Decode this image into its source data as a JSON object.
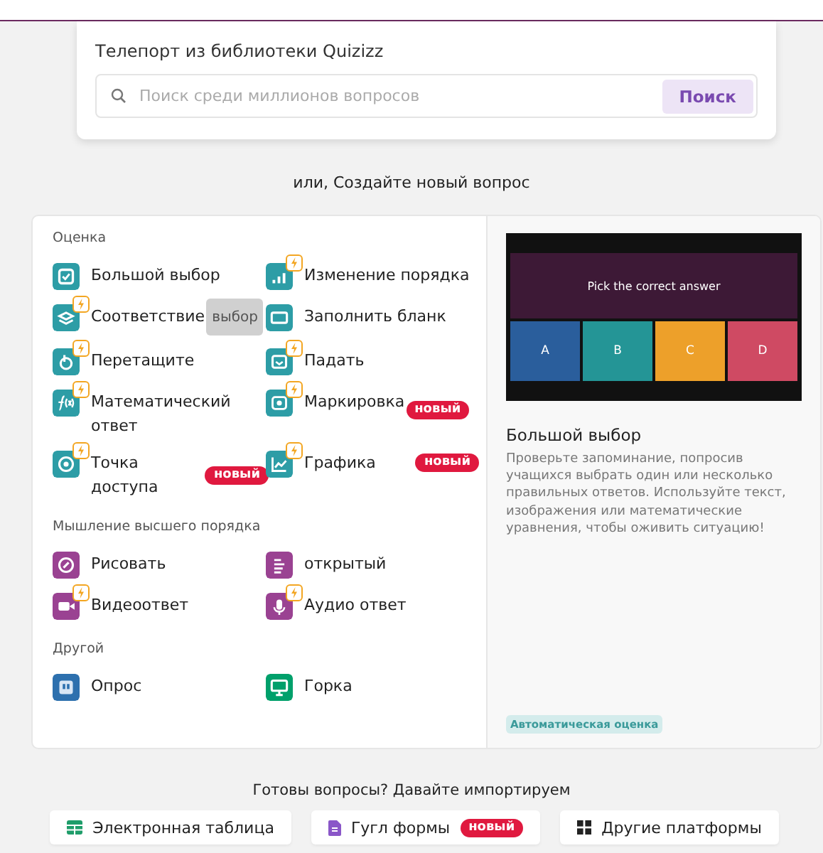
{
  "library": {
    "title": "Телепорт из библиотеки Quizizz",
    "search": {
      "placeholder": "Поиск среди миллионов вопросов"
    },
    "button": "Поиск"
  },
  "create_heading": "или, Создайте новый вопрос",
  "sections": [
    {
      "title": "Оценка",
      "items": [
        {
          "label": "Большой выбор",
          "kind": "check",
          "color": "#2d9da6",
          "premium": false
        },
        {
          "label": "Изменение порядка",
          "kind": "bars",
          "color": "#2d9da6",
          "premium": true
        },
        {
          "label": "Соответствие",
          "kind": "layers",
          "color": "#2d9da6",
          "premium": true,
          "tooltip": "выбор"
        },
        {
          "label": "Заполнить бланк",
          "kind": "blank",
          "color": "#2d9da6",
          "premium": false
        },
        {
          "label": "Перетащите",
          "kind": "hand",
          "color": "#2d9da6",
          "premium": true
        },
        {
          "label": "Падать",
          "kind": "drop",
          "color": "#2d9da6",
          "premium": true
        },
        {
          "label": "Математический ответ",
          "kind": "math",
          "color": "#2d9da6",
          "premium": true
        },
        {
          "label": "Маркировка",
          "kind": "label",
          "color": "#2d9da6",
          "premium": true,
          "badge": "новый"
        },
        {
          "label": "Точка доступа",
          "kind": "target",
          "color": "#2d9da6",
          "premium": true,
          "badge": "новый"
        },
        {
          "label": "Графика",
          "kind": "chart",
          "color": "#2d9da6",
          "premium": true,
          "badge": "новый"
        }
      ]
    },
    {
      "title": "Мышление высшего порядка",
      "items": [
        {
          "label": "Рисовать",
          "kind": "draw",
          "color": "#9a4292",
          "premium": false
        },
        {
          "label": "открытый",
          "kind": "lines",
          "color": "#9a4292",
          "premium": false
        },
        {
          "label": "Видеоответ",
          "kind": "video",
          "color": "#9a4292",
          "premium": true
        },
        {
          "label": "Аудио ответ",
          "kind": "mic",
          "color": "#9a4292",
          "premium": true
        }
      ]
    },
    {
      "title": "Другой",
      "items": [
        {
          "label": "Опрос",
          "kind": "poll",
          "color": "#2d70ae",
          "premium": false
        },
        {
          "label": "Горка",
          "kind": "slide",
          "color": "#00a06b",
          "premium": false
        }
      ]
    }
  ],
  "preview": {
    "question": "Pick the correct answer",
    "options": [
      {
        "label": "A",
        "color": "#2a5e9c"
      },
      {
        "label": "B",
        "color": "#249596"
      },
      {
        "label": "C",
        "color": "#eda02a"
      },
      {
        "label": "D",
        "color": "#cf4a63"
      }
    ],
    "title": "Большой выбор",
    "description": "Проверьте запоминание, попросив учащихся выбрать один или несколько правильных ответов. Используйте текст, изображения или математические уравнения, чтобы оживить ситуацию!",
    "tag": "Автоматическая оценка"
  },
  "import": {
    "heading": "Готовы вопросы? Давайте импортируем",
    "buttons": [
      {
        "label": "Электронная таблица",
        "kind": "sheet"
      },
      {
        "label": "Гугл формы",
        "kind": "form",
        "badge": "новый"
      },
      {
        "label": "Другие платформы",
        "kind": "grid"
      }
    ]
  }
}
